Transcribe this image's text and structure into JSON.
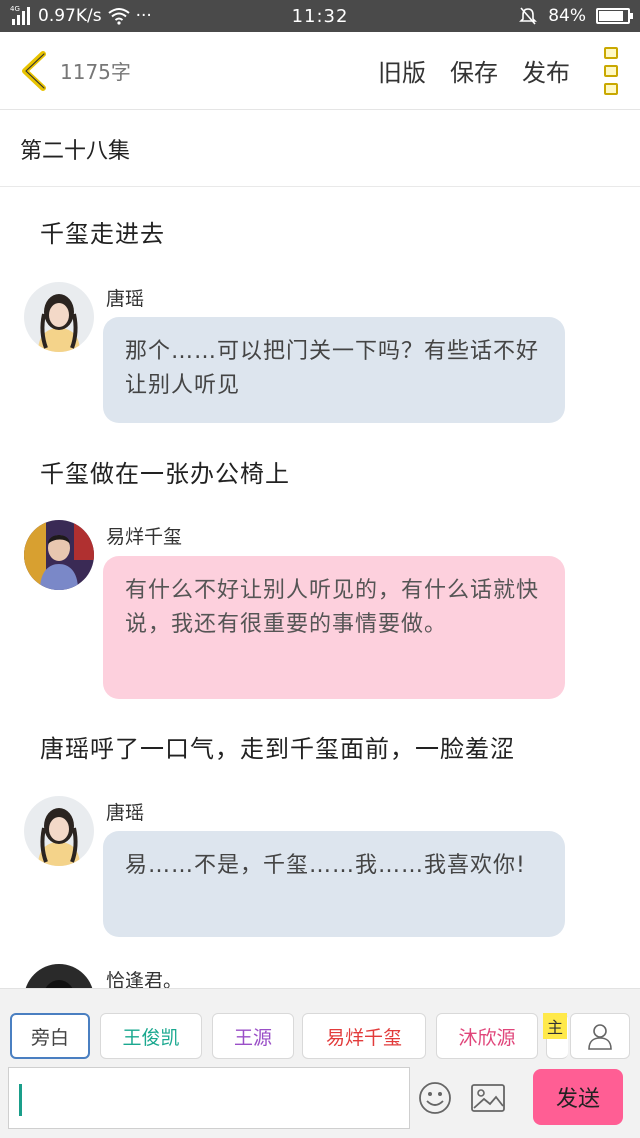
{
  "status_bar": {
    "network": "4G",
    "speed": "0.97K/s",
    "more": "···",
    "time": "11:32",
    "battery": "84%",
    "battery_level": 0.84
  },
  "toolbar": {
    "word_count": "1175字",
    "old_version": "旧版",
    "save": "保存",
    "publish": "发布"
  },
  "episode_title": "第二十八集",
  "script": {
    "narration_1": "千玺走进去",
    "msg_1": {
      "speaker": "唐瑶",
      "text": "那个……可以把门关一下吗？有些话不好让别人听见"
    },
    "narration_2": "千玺做在一张办公椅上",
    "msg_2": {
      "speaker": "易烊千玺",
      "text": "有什么不好让别人听见的，有什么话就快说，我还有很重要的事情要做。"
    },
    "narration_3": "唐瑶呼了一口气，走到千玺面前，一脸羞涩",
    "msg_3": {
      "speaker": "唐瑶",
      "text": "易……不是，千玺……我……我喜欢你!"
    },
    "msg_4": {
      "speaker": "恰逢君。"
    }
  },
  "roles": [
    {
      "label": "旁白",
      "color": "#444444"
    },
    {
      "label": "王俊凯",
      "color": "#1aa88f"
    },
    {
      "label": "王源",
      "color": "#9a4fc7"
    },
    {
      "label": "易烊千玺",
      "color": "#e23b3b"
    },
    {
      "label": "沐欣源",
      "color": "#e0457a"
    }
  ],
  "main_tag": "主",
  "send_label": "发送",
  "colors": {
    "accent_pink": "#ff5e94",
    "bubble_blue": "#dde5ee",
    "bubble_pink": "#fdd0dd",
    "back_arrow": "#e8c300"
  }
}
